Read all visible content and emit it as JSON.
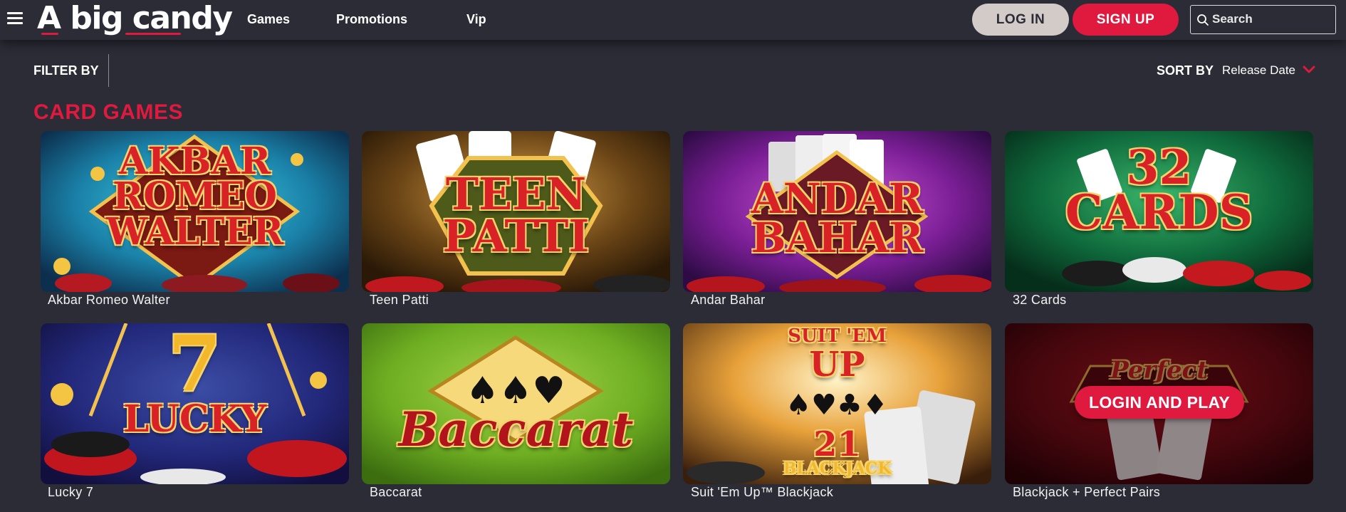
{
  "brand": {
    "logo_text": "A big candy",
    "accent": "#e0193f",
    "background": "#2b2c36"
  },
  "nav": {
    "menu_icon": "hamburger-menu-icon",
    "links": [
      "Games",
      "Promotions",
      "Vip"
    ]
  },
  "auth": {
    "login_label": "LOG IN",
    "signup_label": "SIGN UP"
  },
  "search": {
    "placeholder": "Search",
    "icon": "search-icon"
  },
  "filters": {
    "filter_label": "FILTER BY",
    "sort_label": "SORT BY",
    "sort_value": "Release Date",
    "sort_icon": "chevron-down-icon"
  },
  "section": {
    "title": "CARD GAMES"
  },
  "games": [
    {
      "name": "Akbar Romeo Walter",
      "art_text": [
        "AKBAR",
        "ROMEO",
        "WALTER"
      ]
    },
    {
      "name": "Teen Patti",
      "art_text": [
        "TEEN",
        "PATTI"
      ]
    },
    {
      "name": "Andar Bahar",
      "art_text": [
        "ANDAR",
        "BAHAR"
      ]
    },
    {
      "name": "32 Cards",
      "art_text": [
        "32",
        "CARDS"
      ]
    },
    {
      "name": "Lucky 7",
      "art_text": [
        "7",
        "LUCKY"
      ]
    },
    {
      "name": "Baccarat",
      "art_text": [
        "Baccarat"
      ]
    },
    {
      "name": "Suit 'Em Up™ Blackjack",
      "art_text": [
        "SUIT 'EM",
        "UP",
        "21",
        "BLACKJACK"
      ]
    },
    {
      "name": "Blackjack + Perfect Pairs",
      "art_text": [
        "Perfect"
      ],
      "hover_button": "LOGIN AND PLAY"
    }
  ]
}
